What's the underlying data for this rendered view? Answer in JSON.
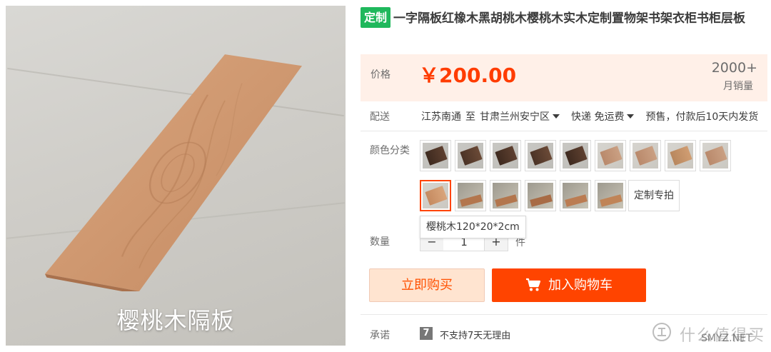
{
  "photo": {
    "caption": "樱桃木隔板"
  },
  "product": {
    "tag": "定制",
    "title": "一字隔板红橡木黑胡桃木樱桃木实木定制置物架书架衣柜书柜层板"
  },
  "price": {
    "label": "价格",
    "value": "￥200.00",
    "sales_count": "2000+",
    "sales_label": "月销量"
  },
  "shipping": {
    "label": "配送",
    "from": "江苏南通",
    "to_word": "至",
    "destination": "甘肃兰州安宁区",
    "method": "快递 免运费",
    "note": "预售，付款后10天内发货"
  },
  "color": {
    "label": "颜色分类",
    "custom_label": "定制专拍",
    "tooltip": "樱桃木120*20*2cm",
    "selected_index": 9
  },
  "quantity": {
    "label": "数量",
    "minus": "−",
    "value": "1",
    "plus": "+",
    "unit": "件"
  },
  "actions": {
    "buy_now": "立即购买",
    "add_to_cart": "加入购物车"
  },
  "promise": {
    "label": "承诺",
    "icon_text": "7",
    "text": "不支持7天无理由"
  },
  "watermark": {
    "text1": "什么值得买",
    "text2": "SMYZ.NET"
  },
  "colors": {
    "price": "#ff3c00",
    "cart_button": "#ff4400",
    "buy_button_bg": "#ffe4d0",
    "tag": "#1fb85c",
    "price_box_bg": "#fff0e8"
  }
}
